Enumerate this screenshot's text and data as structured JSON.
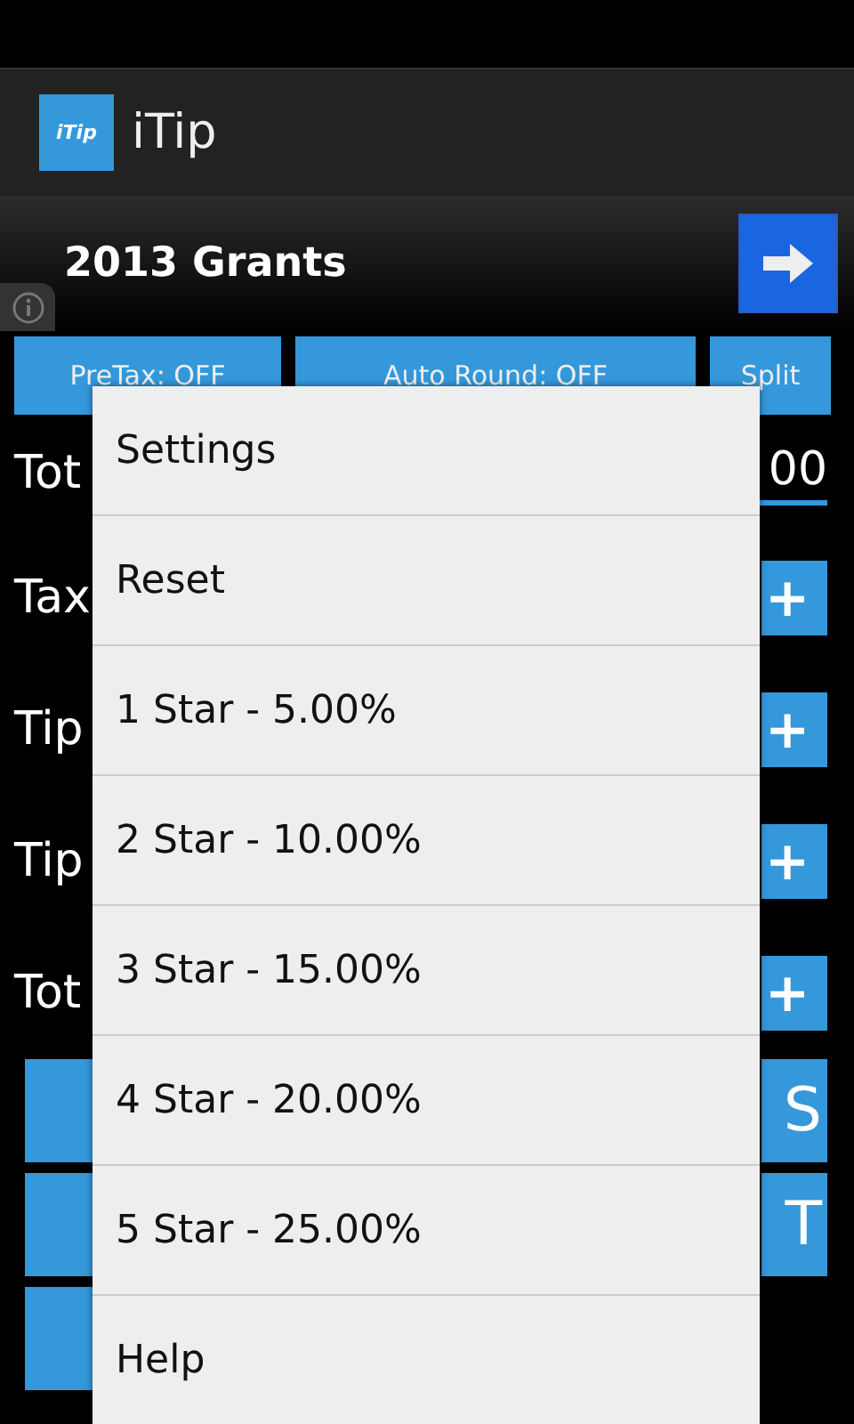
{
  "action_bar": {
    "logo_text": "iTip",
    "title": "iTip"
  },
  "header": {
    "title": "2013 Grants"
  },
  "toggles": [
    {
      "label": "PreTax: OFF"
    },
    {
      "label": "Auto Round: OFF"
    },
    {
      "label": "Split"
    }
  ],
  "rows": [
    {
      "kind": "field",
      "label": "Tot",
      "value": "00"
    },
    {
      "kind": "stepper",
      "label": "Tax",
      "button": "+"
    },
    {
      "kind": "stepper",
      "label": "Tip",
      "button": "+"
    },
    {
      "kind": "stepper",
      "label": "Tip",
      "button": "+"
    },
    {
      "kind": "stepper",
      "label": "Tot",
      "button": "+"
    }
  ],
  "keypad": [
    {
      "kind": "pair",
      "right": "S"
    },
    {
      "kind": "pair",
      "right": "T"
    },
    {
      "kind": "single"
    }
  ],
  "menu": {
    "items": [
      {
        "label": "Settings"
      },
      {
        "label": "Reset"
      },
      {
        "label": "1 Star - 5.00%"
      },
      {
        "label": "2 Star - 10.00%"
      },
      {
        "label": "3 Star - 15.00%"
      },
      {
        "label": "4 Star - 20.00%"
      },
      {
        "label": "5 Star - 25.00%"
      },
      {
        "label": "Help"
      }
    ]
  }
}
